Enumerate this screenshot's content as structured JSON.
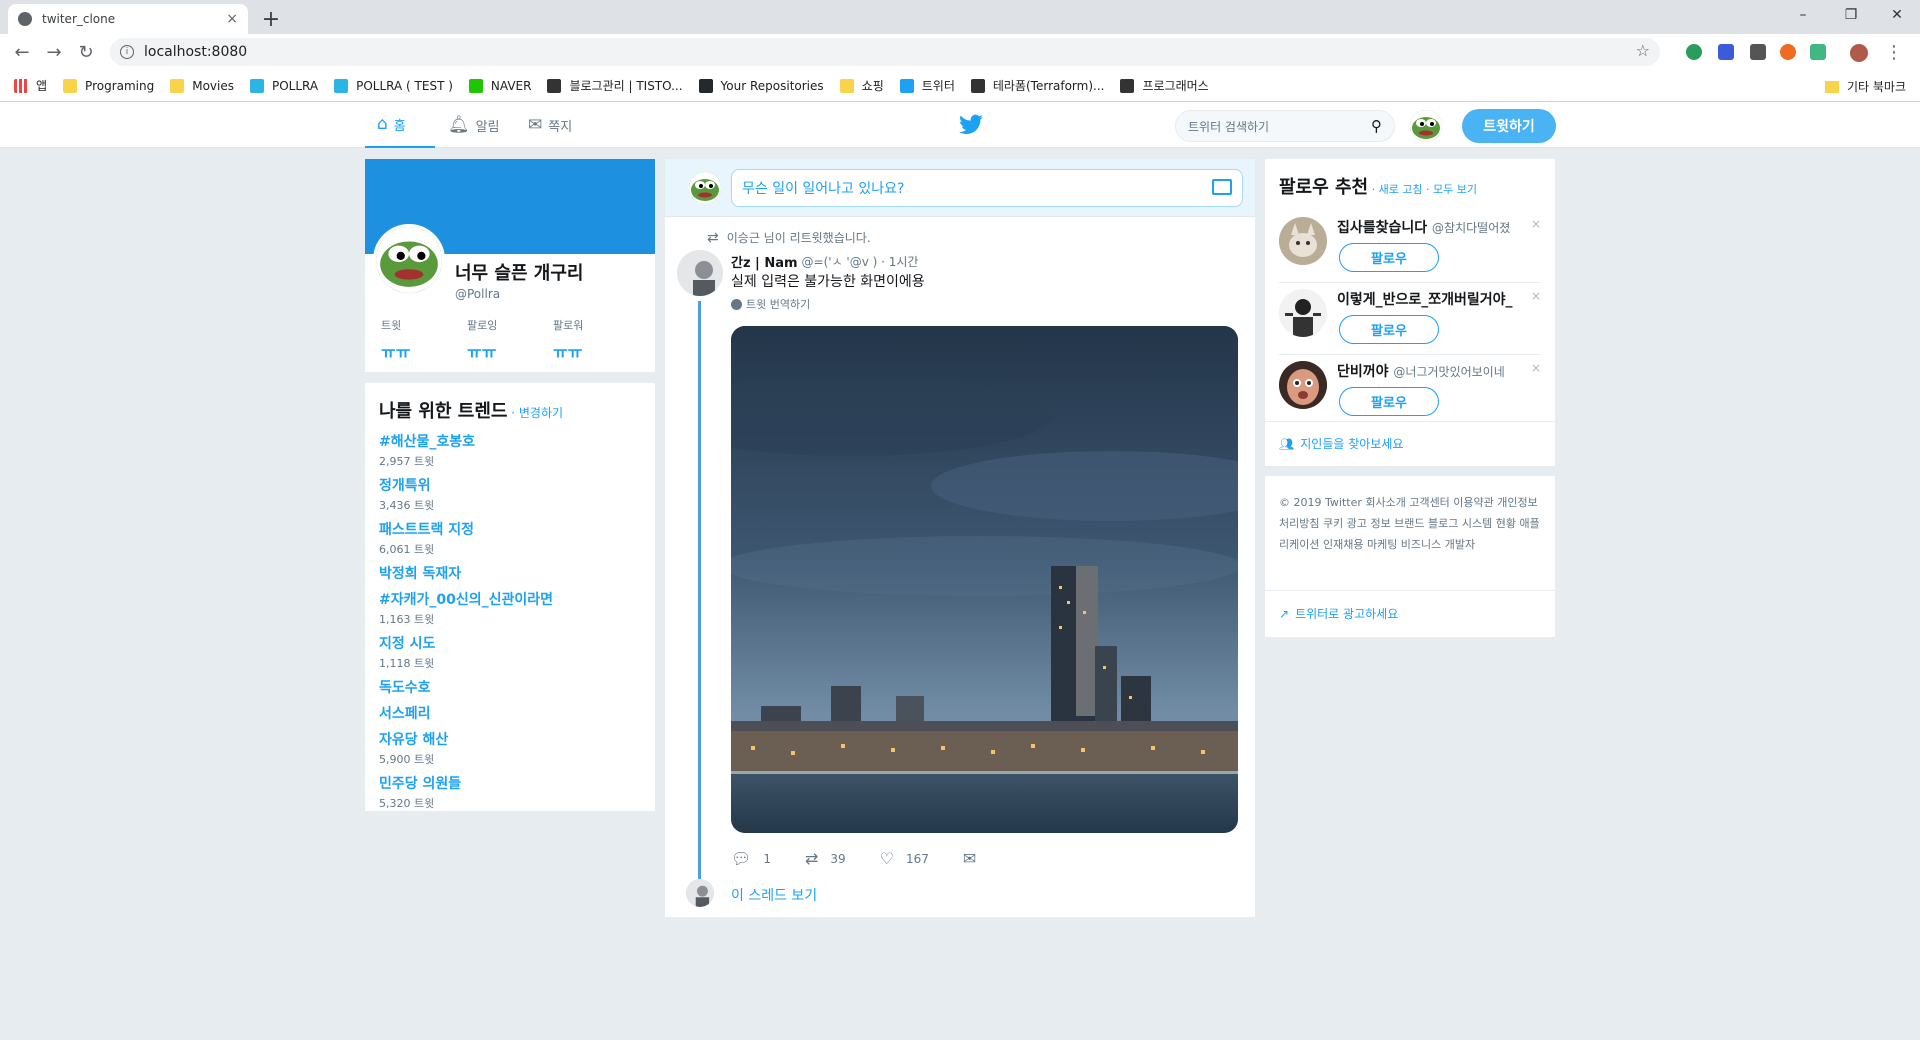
{
  "browser": {
    "tab_title": "twiter_clone",
    "tab_close": "×",
    "new_tab": "+",
    "url": "localhost:8080",
    "window_controls": [
      "–",
      "❐",
      "✕"
    ]
  },
  "bookmarks": {
    "apps_label": "앱",
    "items": [
      {
        "label": "Programing",
        "icon": "folder-icon",
        "color": "#f9d34a"
      },
      {
        "label": "Movies",
        "icon": "folder-icon",
        "color": "#f9d34a"
      },
      {
        "label": "POLLRA",
        "icon": "m-icon",
        "color": "#2bb5e3"
      },
      {
        "label": "POLLRA ( TEST )",
        "icon": "m-icon",
        "color": "#2bb5e3"
      },
      {
        "label": "NAVER",
        "icon": "naver-icon",
        "color": "#1ec800"
      },
      {
        "label": "블로그관리 | TISTO...",
        "icon": "tistory-icon",
        "color": "#333333"
      },
      {
        "label": "Your Repositories",
        "icon": "github-icon",
        "color": "#24292e"
      },
      {
        "label": "쇼핑",
        "icon": "folder-icon",
        "color": "#f9d34a"
      },
      {
        "label": "트위터",
        "icon": "twitter-icon",
        "color": "#1da1f2"
      },
      {
        "label": "테라폼(Terraform)...",
        "icon": "terraform-icon",
        "color": "#333333"
      },
      {
        "label": "프로그래머스",
        "icon": "programmers-icon",
        "color": "#333333"
      }
    ],
    "other": "기타 북마크"
  },
  "nav": {
    "home": "홈",
    "notifications": "알림",
    "messages": "쪽지",
    "search_placeholder": "트위터 검색하기",
    "tweet_button": "트윗하기",
    "brand_color": "#1da1f2"
  },
  "profile": {
    "name": "너무 슬픈 개구리",
    "handle": "@Pollra",
    "stats": [
      {
        "label": "트윗",
        "value": "ㅠㅠ"
      },
      {
        "label": "팔로잉",
        "value": "ㅠㅠ"
      },
      {
        "label": "팔로워",
        "value": "ㅠㅠ"
      }
    ]
  },
  "trends": {
    "title": "나를 위한 트렌드",
    "change": " · 변경하기",
    "items": [
      {
        "name": "#해산물_호봉호",
        "count": "2,957 트윗"
      },
      {
        "name": "정개특위",
        "count": "3,436 트윗"
      },
      {
        "name": "패스트트랙 지정",
        "count": "6,061 트윗"
      },
      {
        "name": "박정희 독재자",
        "count": ""
      },
      {
        "name": "#자캐가_00신의_신관이라면",
        "count": "1,163 트윗"
      },
      {
        "name": "지정 시도",
        "count": "1,118 트윗"
      },
      {
        "name": "독도수호",
        "count": ""
      },
      {
        "name": "서스페리",
        "count": ""
      },
      {
        "name": "자유당 해산",
        "count": "5,900 트윗"
      },
      {
        "name": "민주당 의원들",
        "count": "5,320 트윗"
      }
    ]
  },
  "composer": {
    "placeholder": "무슨 일이 일어나고 있나요?"
  },
  "tweet": {
    "context": "이승근 님이 리트윗했습니다.",
    "author": "간z | Nam",
    "handle": "@=('ㅅ '@v ) · 1시간",
    "text": "실제 입력은 불가능한 화면이에용",
    "translate": "트윗 번역하기",
    "replies": "1",
    "retweets": "39",
    "likes": "167",
    "thread_link": "이 스레드 보기"
  },
  "who_to_follow": {
    "title": "팔로우 추천",
    "refresh": " · 새로 고침",
    "view_all": " · 모두 보기",
    "follow_label": "팔로우",
    "close": "×",
    "items": [
      {
        "name": "집사를찾습니다",
        "handle": "@참치다떨어졌"
      },
      {
        "name": "이렇게_반으로_쪼개버릴거야_",
        "handle": ""
      },
      {
        "name": "단비꺼야",
        "handle": "@너그거맛있어보이네"
      }
    ],
    "find_friends": "지인들을 찾아보세요"
  },
  "footer": {
    "links": "© 2019 Twitter  회사소개  고객센터  이용약관  개인정보 처리방침  쿠키  광고 정보  브랜드  블로그  시스템 현황  애플리케이션  인재채용  마케팅  비즈니스  개발자",
    "ads": "트위터로 광고하세요"
  }
}
